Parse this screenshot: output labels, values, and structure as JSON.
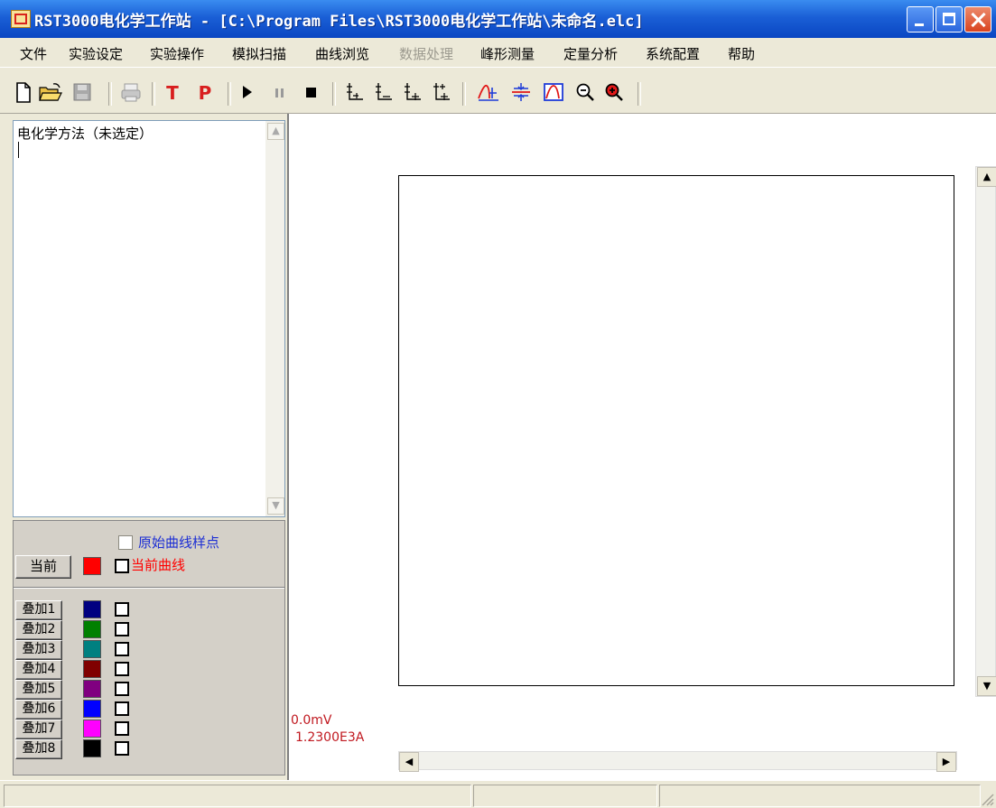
{
  "window": {
    "title": "RST3000电化学工作站 - [C:\\Program Files\\RST3000电化学工作站\\未命名.elc]"
  },
  "menu": [
    {
      "label": "文件",
      "enabled": true
    },
    {
      "label": "实验设定",
      "enabled": true
    },
    {
      "label": "实验操作",
      "enabled": true
    },
    {
      "label": "模拟扫描",
      "enabled": true
    },
    {
      "label": "曲线浏览",
      "enabled": true
    },
    {
      "label": "数据处理",
      "enabled": false
    },
    {
      "label": "峰形测量",
      "enabled": true
    },
    {
      "label": "定量分析",
      "enabled": true
    },
    {
      "label": "系统配置",
      "enabled": true
    },
    {
      "label": "帮助",
      "enabled": true
    }
  ],
  "toolbar": {
    "t_label": "T",
    "p_label": "P",
    "icons": [
      "new-file-icon",
      "open-folder-icon",
      "save-icon",
      "print-icon",
      "t-icon",
      "p-icon",
      "run-icon",
      "pause-icon",
      "stop-icon",
      "axis1-icon",
      "axis2-icon",
      "axis3-icon",
      "axis4-icon",
      "peak-icon",
      "baseline-icon",
      "peak-window-icon",
      "zoom-out-icon",
      "zoom-in-icon"
    ]
  },
  "method_panel": {
    "text": "电化学方法（未选定）"
  },
  "curve_panel": {
    "raw_points_label": "原始曲线样点",
    "current_button": "当前",
    "current_curve_label": "当前曲线",
    "current_color": "#ff0000",
    "overlays": [
      {
        "label": "叠加1",
        "color": "#000080"
      },
      {
        "label": "叠加2",
        "color": "#008000"
      },
      {
        "label": "叠加3",
        "color": "#008080"
      },
      {
        "label": "叠加4",
        "color": "#800000"
      },
      {
        "label": "叠加5",
        "color": "#800080"
      },
      {
        "label": "叠加6",
        "color": "#0000ff"
      },
      {
        "label": "叠加7",
        "color": "#ff00ff"
      },
      {
        "label": "叠加8",
        "color": "#000000"
      }
    ]
  },
  "plot": {
    "readout_potential": "0.0mV",
    "readout_current": "1.2300E3A"
  },
  "colors": {
    "titlebar": "#0a46c2",
    "readout": "#c0181f"
  }
}
